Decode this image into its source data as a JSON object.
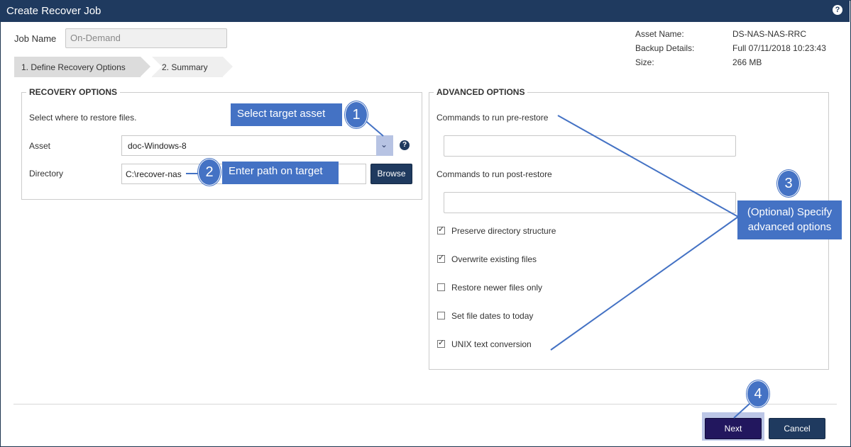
{
  "window": {
    "title": "Create Recover Job",
    "help_icon": "?"
  },
  "job": {
    "name_label": "Job Name",
    "name_value": "On-Demand"
  },
  "steps": [
    {
      "label": "1. Define Recovery Options"
    },
    {
      "label": "2. Summary"
    }
  ],
  "info": {
    "asset_name_label": "Asset Name:",
    "asset_name_value": "DS-NAS-NAS-RRC",
    "backup_details_label": "Backup Details:",
    "backup_details_value": "Full 07/11/2018 10:23:43",
    "size_label": "Size:",
    "size_value": "266 MB"
  },
  "recovery": {
    "legend": "RECOVERY OPTIONS",
    "hint": "Select where to restore files.",
    "asset_label": "Asset",
    "asset_value": "doc-Windows-8",
    "directory_label": "Directory",
    "directory_value": "C:\\recover-nas",
    "browse_label": "Browse",
    "help_icon": "?"
  },
  "advanced": {
    "legend": "ADVANCED OPTIONS",
    "pre_label": "Commands to run pre-restore",
    "post_label": "Commands to run post-restore",
    "options": [
      {
        "label": "Preserve directory structure",
        "checked": true
      },
      {
        "label": "Overwrite existing files",
        "checked": true
      },
      {
        "label": "Restore newer files only",
        "checked": false
      },
      {
        "label": "Set file dates to today",
        "checked": false
      },
      {
        "label": "UNIX text conversion",
        "checked": true
      }
    ]
  },
  "footer": {
    "next_label": "Next",
    "cancel_label": "Cancel"
  },
  "callouts": {
    "c1_num": "1",
    "c1_text": "Select target asset",
    "c2_num": "2",
    "c2_text": "Enter path on target",
    "c3_num": "3",
    "c3_text": "(Optional) Specify advanced options",
    "c4_num": "4"
  },
  "colors": {
    "header": "#1f3a5f",
    "callout": "#4472c4",
    "next": "#22175e"
  }
}
